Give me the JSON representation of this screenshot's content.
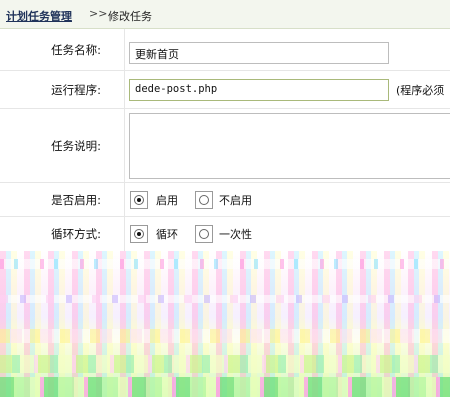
{
  "breadcrumb": {
    "parent": "计划任务管理",
    "separator": ">>",
    "current": "修改任务"
  },
  "form": {
    "task_name": {
      "label": "任务名称:",
      "value": "更新首页"
    },
    "program": {
      "label": "运行程序:",
      "value": "dede-post.php",
      "hint": "(程序必须"
    },
    "description": {
      "label": "任务说明:",
      "value": ""
    },
    "enabled": {
      "label": "是否启用:",
      "options": [
        "启用",
        "不启用"
      ],
      "selected": "启用"
    },
    "loop": {
      "label": "循环方式:",
      "options": [
        "循环",
        "一次性"
      ],
      "selected": "循环"
    }
  }
}
